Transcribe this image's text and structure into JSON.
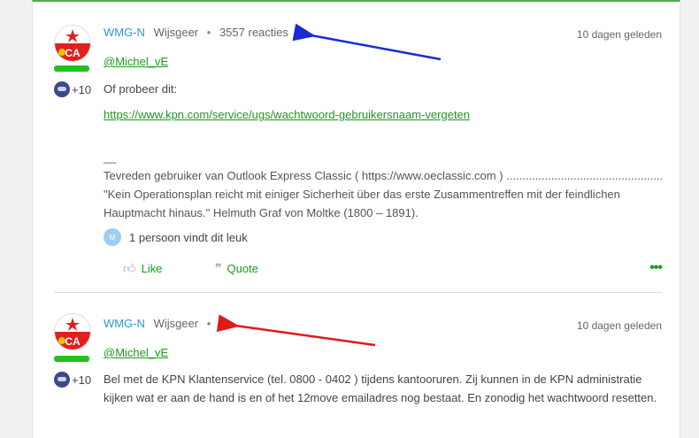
{
  "posts": [
    {
      "username": "WMG-N",
      "rank": "Wijsgeer",
      "reactions": "3557 reacties",
      "date": "10 dagen geleden",
      "kudos": "+10",
      "mention": "@Michel_vE",
      "body_line1": "Of probeer dit:",
      "link": "https://www.kpn.com/service/ugs/wachtwoord-gebruikersnaam-vergeten",
      "sig_sep": "__",
      "sig_line1": "Tevreden gebruiker van Outlook Express Classic ( https://www.oeclassic.com ) ......................................................",
      "sig_line2": "\"Kein Operationsplan reicht mit einiger Sicherheit über das erste Zusammentreffen mit der feindlichen Hauptmacht hinaus.\" Helmuth Graf von Moltke (1800 – 1891).",
      "likers_avatar": "M",
      "likers_text": "1 persoon vindt dit leuk",
      "like_label": "Like",
      "quote_label": "Quote",
      "more_label": "•••"
    },
    {
      "username": "WMG-N",
      "rank": "Wijsgeer",
      "date": "10 dagen geleden",
      "kudos": "+10",
      "mention": "@Michel_vE",
      "body": "Bel met de KPN Klantenservice (tel. 0800 - 0402 ) tijdens kantooruren. Zij kunnen in de KPN administratie kijken wat er aan de hand is en of het 12move emailadres nog bestaat. En zonodig het wachtwoord resetten."
    }
  ],
  "colors": {
    "accent_green": "#1c9b1c",
    "username_blue": "#2a97d6",
    "arrow_blue": "#1a2bd6",
    "arrow_red": "#e01a1a"
  },
  "icons": [
    "thumbs-up-icon",
    "quote-icon",
    "more-dots-icon",
    "kudos-medal-icon"
  ]
}
